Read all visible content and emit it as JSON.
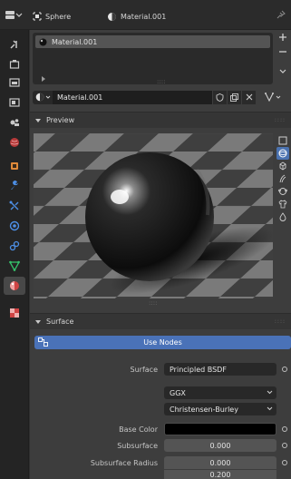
{
  "header": {
    "object_name": "Sphere",
    "material_name": "Material.001"
  },
  "tabs": [
    {
      "icon": "tool-icon"
    },
    {
      "icon": "render-icon"
    },
    {
      "icon": "output-icon"
    },
    {
      "icon": "view-layer-icon"
    },
    {
      "icon": "scene-icon"
    },
    {
      "icon": "world-icon"
    },
    {
      "icon": "object-icon"
    },
    {
      "icon": "modifier-icon"
    },
    {
      "icon": "particles-icon"
    },
    {
      "icon": "physics-icon"
    },
    {
      "icon": "constraints-icon"
    },
    {
      "icon": "object-data-icon"
    },
    {
      "icon": "material-icon",
      "active": true
    },
    {
      "icon": "texture-icon"
    }
  ],
  "material_slots": {
    "items": [
      "Material.001"
    ]
  },
  "material": {
    "name": "Material.001"
  },
  "preview": {
    "title": "Preview"
  },
  "surface": {
    "title": "Surface",
    "use_nodes_label": "Use Nodes",
    "surface_label": "Surface",
    "surface_value": "Principled BSDF",
    "distribution": "GGX",
    "subsurface_method": "Christensen-Burley",
    "base_color_label": "Base Color",
    "base_color": "#000000",
    "subsurface_label": "Subsurface",
    "subsurface_value": "0.000",
    "subsurface_radius_label": "Subsurface Radius",
    "subsurface_radius_values": [
      "0.000",
      "0.200"
    ]
  },
  "colors": {
    "accent": "#4a72b8",
    "panel": "#3d3d3d",
    "header": "#2b2b2b"
  }
}
